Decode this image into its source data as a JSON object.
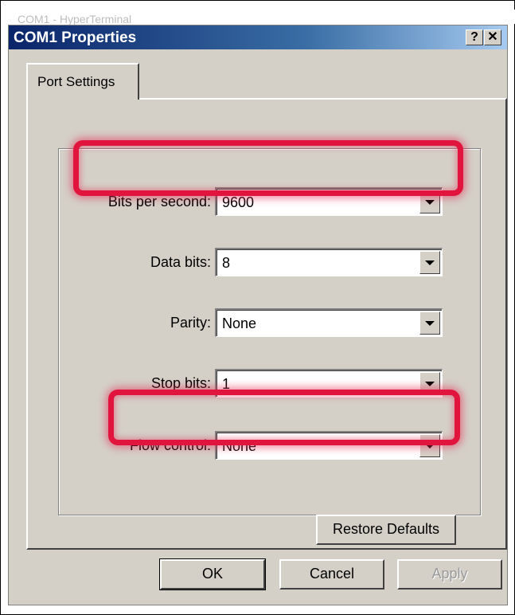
{
  "window": {
    "title": "COM1 Properties",
    "help_glyph": "?",
    "close_glyph": "✕",
    "background_text": "COM1 - HyperTerminal"
  },
  "tabs": [
    {
      "label": "Port Settings",
      "active": true
    }
  ],
  "settings": [
    {
      "label": "Bits per second:",
      "value": "9600",
      "highlighted": true
    },
    {
      "label": "Data bits:",
      "value": "8",
      "highlighted": false
    },
    {
      "label": "Parity:",
      "value": "None",
      "highlighted": false
    },
    {
      "label": "Stop bits:",
      "value": "1",
      "highlighted": false
    },
    {
      "label": "Flow control:",
      "value": "None",
      "highlighted": true
    }
  ],
  "buttons": {
    "restore_defaults": "Restore Defaults",
    "ok": "OK",
    "cancel": "Cancel",
    "apply": "Apply",
    "apply_enabled": false
  },
  "colors": {
    "highlight": "#e0143c",
    "titlebar_start": "#0a246a",
    "titlebar_end": "#a6caf0",
    "dialog_face": "#d4d0c8"
  }
}
